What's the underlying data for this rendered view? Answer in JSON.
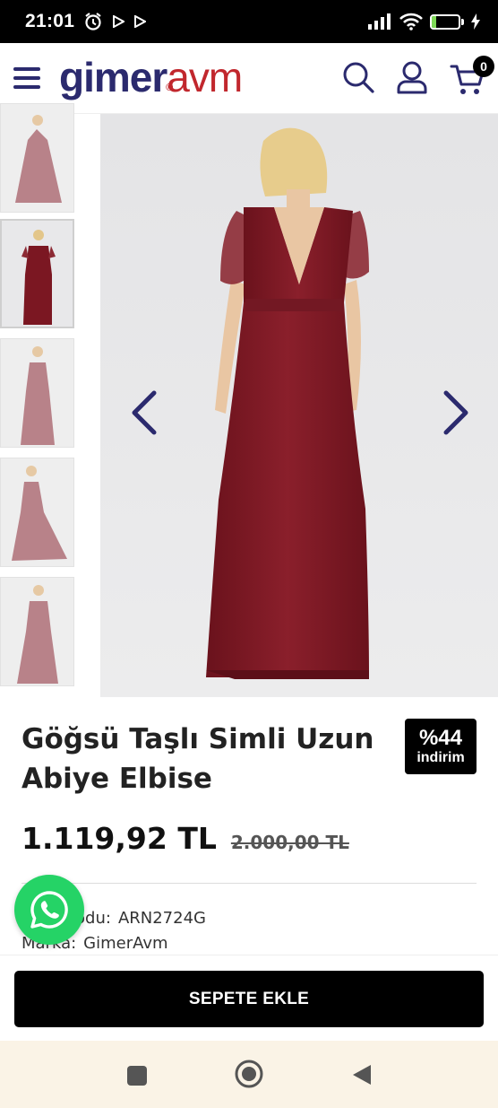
{
  "status_bar": {
    "time": "21:01",
    "battery_level": "15",
    "battery_fraction": 0.15
  },
  "header": {
    "logo_primary": "gimer",
    "logo_secondary": "avm",
    "logo_mark": "®",
    "menu_icon": "hamburger-icon",
    "search_icon": "search-icon",
    "account_icon": "user-icon",
    "cart_icon": "cart-icon",
    "cart_count": "0"
  },
  "gallery": {
    "thumbnail_count": 5,
    "active_thumbnail": 1,
    "prev_icon": "chevron-left-icon",
    "next_icon": "chevron-right-icon"
  },
  "product": {
    "title": "Göğsü Taşlı Simli Uzun Abiye Elbise",
    "discount_percent": "%44",
    "discount_label": "indirim",
    "price_current": "1.119,92 TL",
    "price_old": "2.000,00 TL",
    "code_label": "Ürün Kodu:",
    "code_value": "ARN2724G",
    "brand_label": "Marka:",
    "brand_value": "GimerAvm"
  },
  "actions": {
    "add_to_cart": "SEPETE EKLE",
    "whatsapp_icon": "whatsapp-icon"
  },
  "colors": {
    "brand_navy": "#2b2a6e",
    "brand_red": "#c1272d",
    "dress": "#7b1722",
    "whatsapp": "#25d366"
  }
}
